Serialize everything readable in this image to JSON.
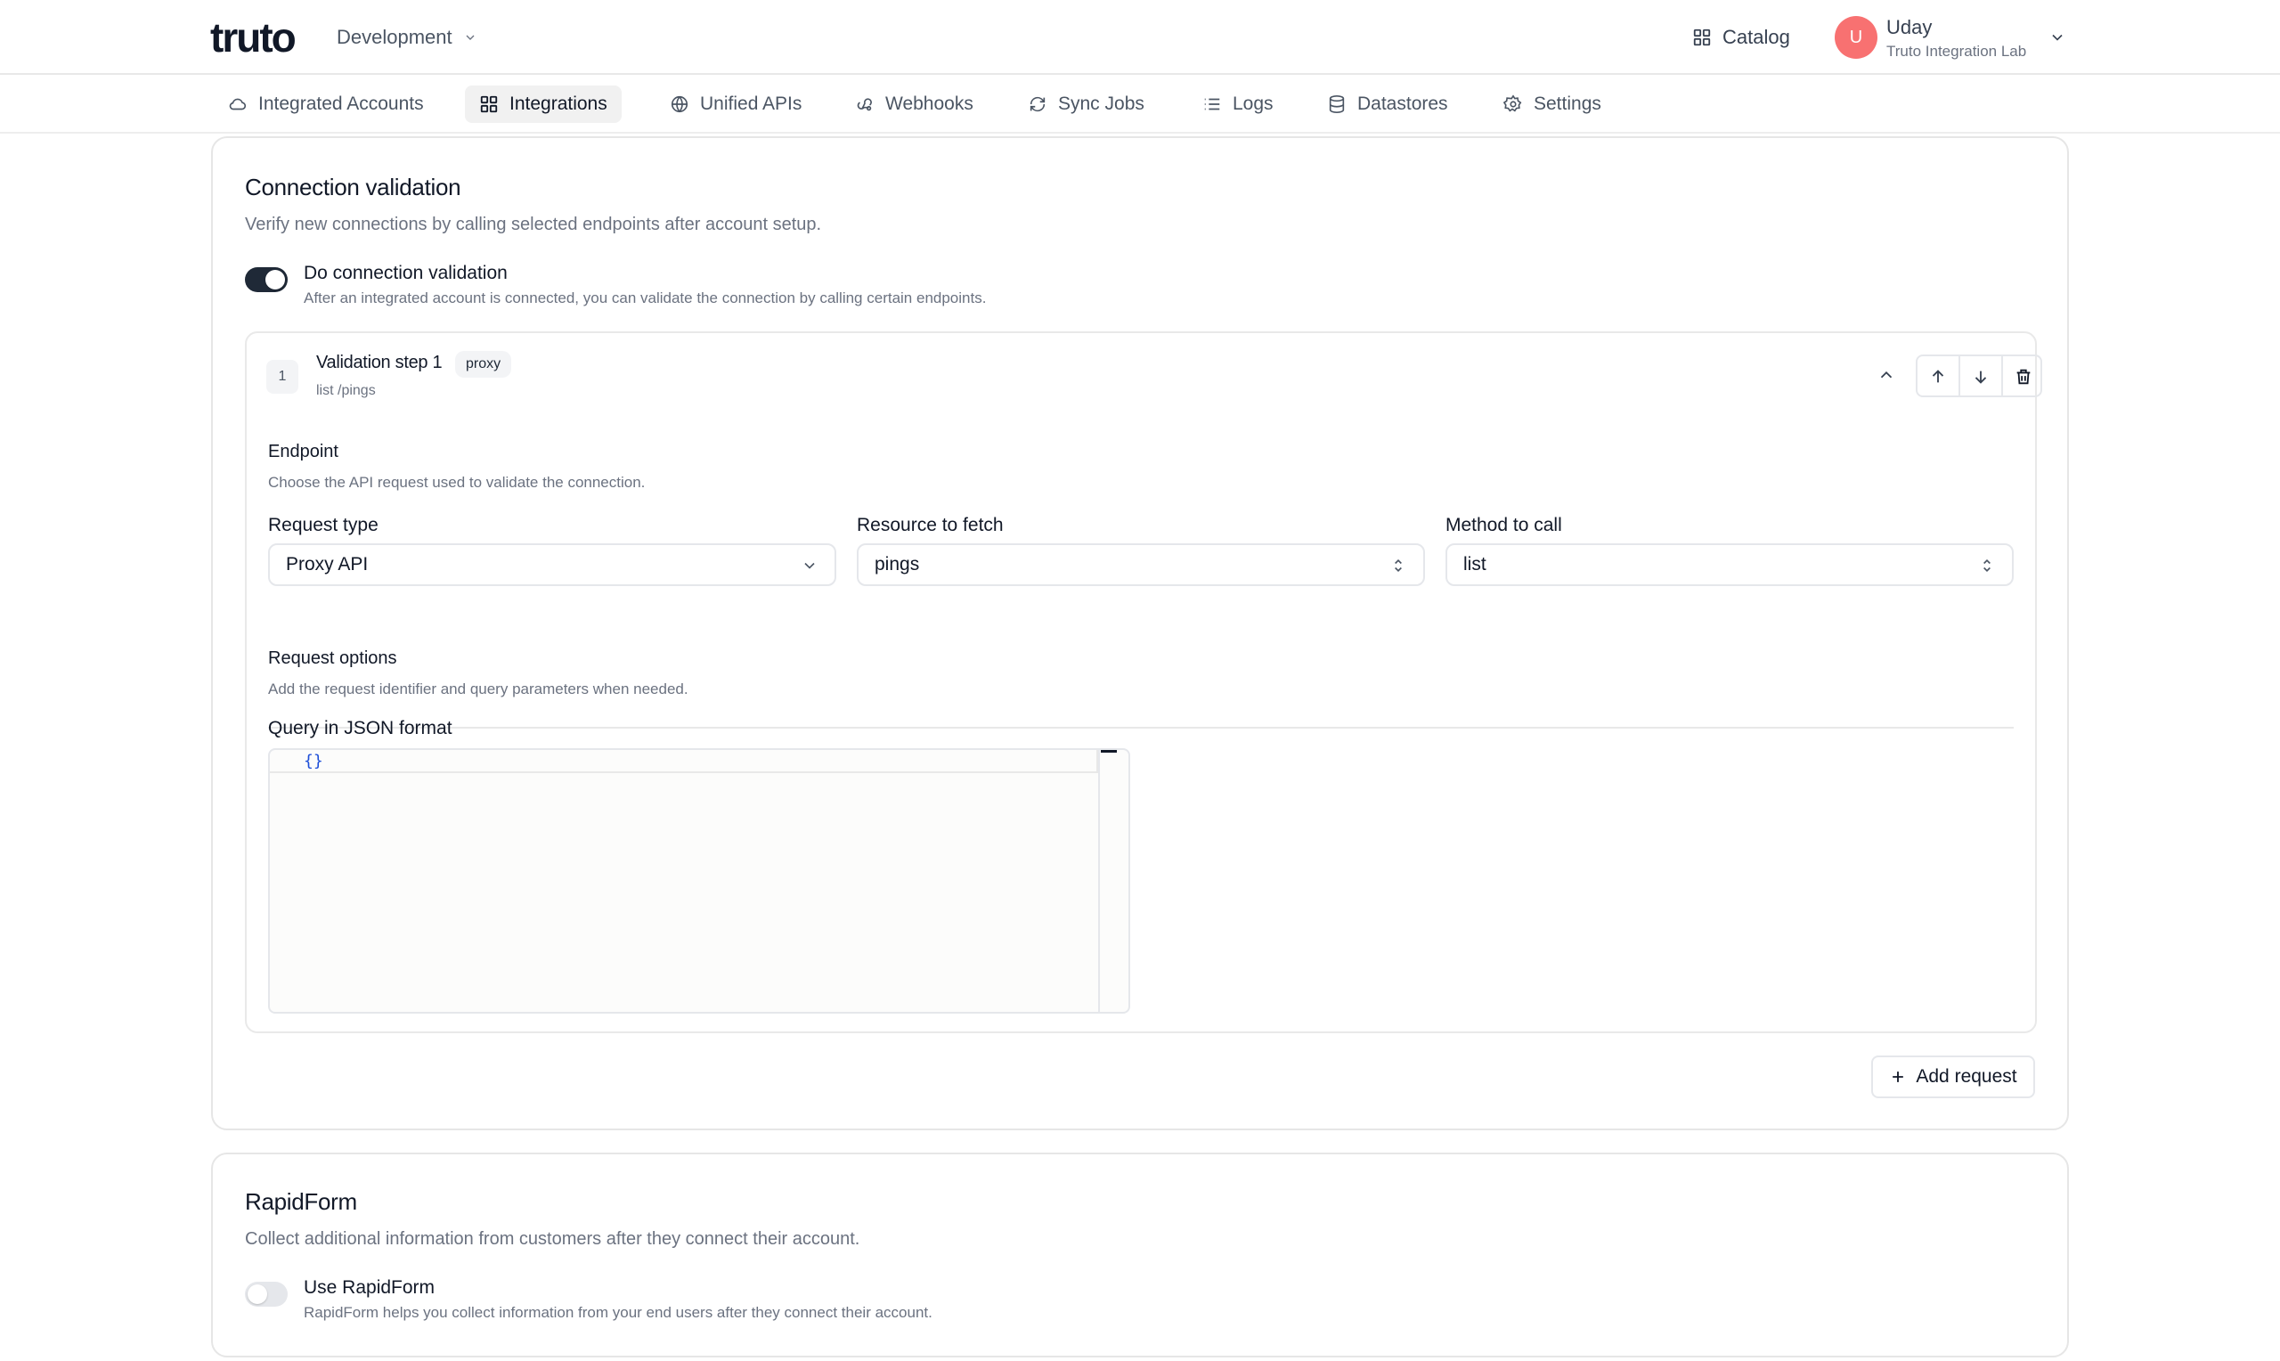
{
  "header": {
    "logo_text": "truto",
    "environment": "Development",
    "catalog_label": "Catalog",
    "user": {
      "initial": "U",
      "name": "Uday",
      "org": "Truto Integration Lab"
    }
  },
  "nav": {
    "items": [
      {
        "label": "Integrated Accounts",
        "icon": "cloud-icon"
      },
      {
        "label": "Integrations",
        "icon": "grid-icon",
        "active": true
      },
      {
        "label": "Unified APIs",
        "icon": "globe-icon"
      },
      {
        "label": "Webhooks",
        "icon": "webhook-icon"
      },
      {
        "label": "Sync Jobs",
        "icon": "sync-icon"
      },
      {
        "label": "Logs",
        "icon": "list-icon"
      },
      {
        "label": "Datastores",
        "icon": "database-icon"
      },
      {
        "label": "Settings",
        "icon": "gear-icon"
      }
    ]
  },
  "connection_validation": {
    "title": "Connection validation",
    "description": "Verify new connections by calling selected endpoints after account setup.",
    "toggle_label": "Do connection validation",
    "toggle_desc": "After an integrated account is connected, you can validate the connection by calling certain endpoints.",
    "toggle_on": true,
    "step": {
      "number": "1",
      "title": "Validation step 1",
      "badge": "proxy",
      "subtitle": "list /pings",
      "endpoint_label": "Endpoint",
      "endpoint_desc": "Choose the API request used to validate the connection.",
      "request_type_label": "Request type",
      "request_type_value": "Proxy API",
      "resource_label": "Resource to fetch",
      "resource_value": "pings",
      "method_label": "Method to call",
      "method_value": "list",
      "options_label": "Request options",
      "options_desc": "Add the request identifier and query parameters when needed.",
      "query_label": "Query in JSON format",
      "query_value": "{}"
    },
    "add_request_label": "Add request"
  },
  "rapidform": {
    "title": "RapidForm",
    "description": "Collect additional information from customers after they connect their account.",
    "toggle_label": "Use RapidForm",
    "toggle_desc": "RapidForm helps you collect information from your end users after they connect their account.",
    "toggle_on": false
  }
}
